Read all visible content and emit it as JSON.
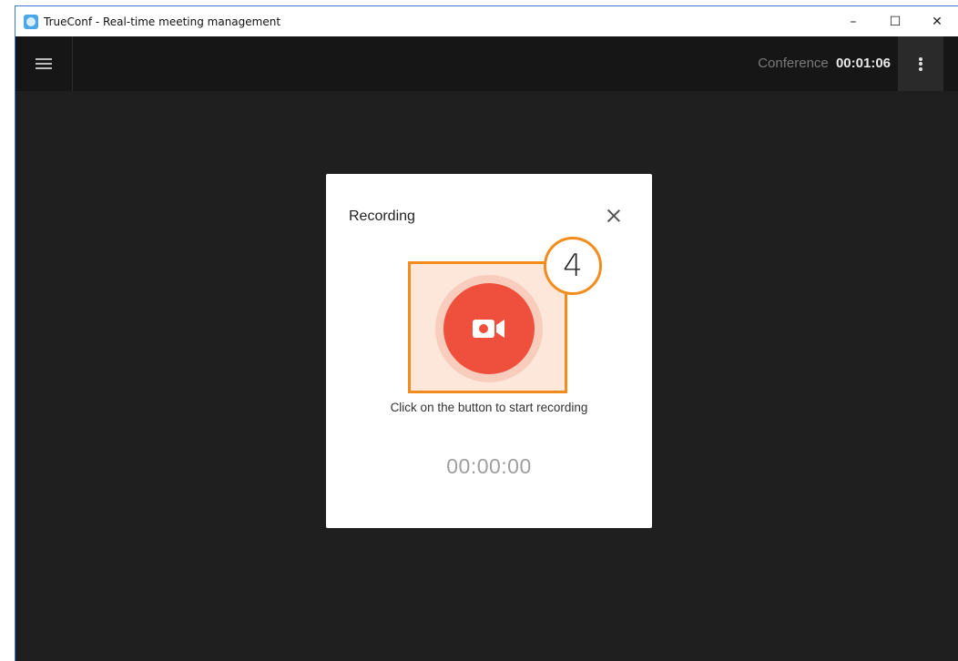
{
  "window": {
    "title": "TrueConf - Real-time meeting management",
    "controls": {
      "minimize": "–",
      "maximize": "☐",
      "close": "✕"
    }
  },
  "topbar": {
    "conference_label": "Conference",
    "conference_time": "00:01:06"
  },
  "recording_dialog": {
    "title": "Recording",
    "step_number": "4",
    "hint": "Click on the button to start recording",
    "timer": "00:00:00"
  },
  "colors": {
    "record_button": "#ef4f3d",
    "highlight_border": "#f28c1c",
    "background": "#1f1f1f"
  },
  "icons": {
    "app": "trueconf-logo-icon",
    "menu": "hamburger-menu-icon",
    "more": "kebab-menu-icon",
    "close": "close-icon",
    "record": "video-camera-icon"
  }
}
